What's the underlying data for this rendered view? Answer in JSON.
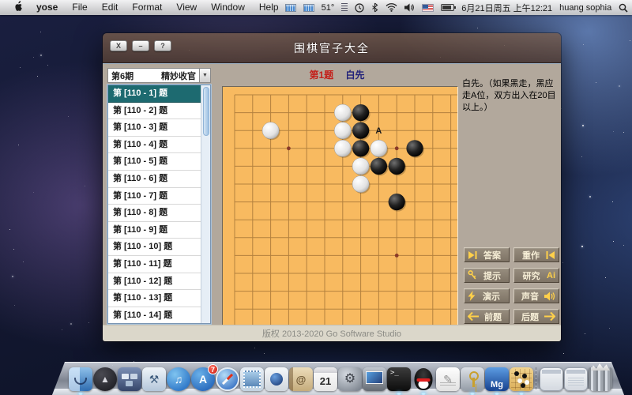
{
  "menu_bar": {
    "items": [
      "yose",
      "File",
      "Edit",
      "Format",
      "View",
      "Window",
      "Help"
    ],
    "status": {
      "temperature": "51°",
      "datetime": "6月21日周五 上午12:21",
      "username": "huang sophia"
    }
  },
  "window": {
    "title": "围棋官子大全",
    "controls": {
      "close": "X",
      "minimize": "–",
      "help": "?"
    },
    "selector": {
      "period": "第6期",
      "category": "精妙收官"
    },
    "problem_list": {
      "selected_index": 0,
      "items": [
        "第 [110 - 1] 题",
        "第 [110 - 2] 题",
        "第 [110 - 3] 题",
        "第 [110 - 4] 题",
        "第 [110 - 5] 题",
        "第 [110 - 6] 题",
        "第 [110 - 7] 题",
        "第 [110 - 8] 题",
        "第 [110 - 9] 题",
        "第 [110 - 10] 题",
        "第 [110 - 11] 题",
        "第 [110 - 12] 题",
        "第 [110 - 13] 题",
        "第 [110 - 14] 题"
      ]
    },
    "board_header": {
      "problem": "第1题",
      "turn": "白先"
    },
    "description": "白先。（如果黑走，黑应走A位，双方出入在20目以上。）",
    "control_buttons": {
      "left": [
        {
          "label": "答案",
          "name": "answer-button",
          "icon": "play-next-icon"
        },
        {
          "label": "提示",
          "name": "hint-button",
          "icon": "key-icon"
        },
        {
          "label": "演示",
          "name": "demo-button",
          "icon": "lightning-icon"
        },
        {
          "label": "前题",
          "name": "prev-problem-button",
          "icon": "arrow-left-icon"
        }
      ],
      "right": [
        {
          "label": "重作",
          "name": "redo-button",
          "icon": "play-prev-icon"
        },
        {
          "label": "研究",
          "name": "research-button",
          "icon": "ai-icon",
          "icon_text": "Ai"
        },
        {
          "label": "声音",
          "name": "sound-button",
          "icon": "speaker-icon"
        },
        {
          "label": "后题",
          "name": "next-problem-button",
          "icon": "arrow-right-icon"
        }
      ]
    },
    "footer": "版权 2013-2020 Go Software Studio"
  },
  "board": {
    "visible_cols": 13,
    "visible_rows": 13,
    "stones": [
      {
        "col": 3,
        "row": 3,
        "color": "white"
      },
      {
        "col": 7,
        "row": 2,
        "color": "white"
      },
      {
        "col": 7,
        "row": 3,
        "color": "white"
      },
      {
        "col": 7,
        "row": 4,
        "color": "white"
      },
      {
        "col": 9,
        "row": 4,
        "color": "white"
      },
      {
        "col": 8,
        "row": 5,
        "color": "white"
      },
      {
        "col": 8,
        "row": 6,
        "color": "white"
      },
      {
        "col": 8,
        "row": 2,
        "color": "black"
      },
      {
        "col": 8,
        "row": 3,
        "color": "black"
      },
      {
        "col": 8,
        "row": 4,
        "color": "black"
      },
      {
        "col": 11,
        "row": 4,
        "color": "black"
      },
      {
        "col": 9,
        "row": 5,
        "color": "black"
      },
      {
        "col": 10,
        "row": 5,
        "color": "black"
      },
      {
        "col": 10,
        "row": 7,
        "color": "black"
      }
    ],
    "star_points": [
      {
        "col": 4,
        "row": 4
      },
      {
        "col": 10,
        "row": 4
      },
      {
        "col": 10,
        "row": 10
      }
    ],
    "marker": {
      "text": "A",
      "col": 9,
      "row": 3
    }
  },
  "colors": {
    "header_problem": "#c4201a",
    "header_turn": "#22227a",
    "selected_item_bg": "#1d6a70",
    "board_bg": "#f8ba60",
    "board_line": "#b3813e",
    "star_point": "#8a3a28",
    "button_icon": "#ffd04a"
  },
  "dock": {
    "apps": [
      {
        "id": "finder",
        "running": true
      },
      {
        "id": "launchpad",
        "glyph": "▲"
      },
      {
        "id": "mission-control"
      },
      {
        "id": "xcode",
        "glyph": "⚒"
      },
      {
        "id": "itunes",
        "glyph": "♫"
      },
      {
        "id": "app-store",
        "glyph": "A",
        "badge": "7"
      },
      {
        "id": "safari"
      },
      {
        "id": "mail"
      },
      {
        "id": "facetime"
      },
      {
        "id": "contacts",
        "glyph": "@"
      },
      {
        "id": "calendar",
        "glyph": "21"
      },
      {
        "id": "system-preferences",
        "glyph": "⚙"
      },
      {
        "id": "remote-desktop"
      },
      {
        "id": "terminal",
        "glyph": ">_",
        "running": true
      },
      {
        "id": "qq",
        "glyph": "",
        "running": true
      },
      {
        "id": "textedit",
        "glyph": "✎"
      },
      {
        "id": "keychain",
        "running": true
      },
      {
        "id": "mg",
        "glyph": "Mg",
        "running": true
      },
      {
        "id": "go-board",
        "running": true
      },
      {
        "id": "divider"
      },
      {
        "id": "stack-window-1"
      },
      {
        "id": "stack-window-2"
      },
      {
        "id": "trash"
      }
    ]
  }
}
